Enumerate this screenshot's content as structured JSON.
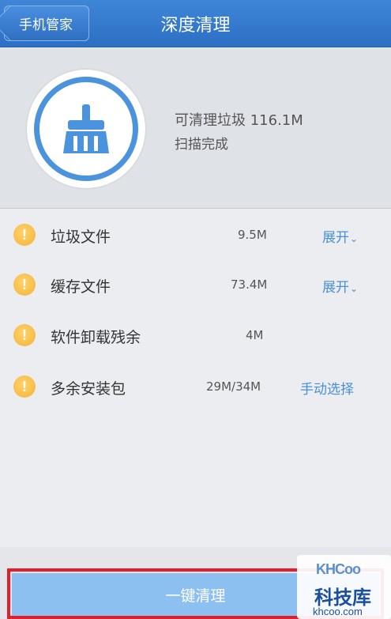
{
  "header": {
    "back_label": "手机管家",
    "title": "深度清理"
  },
  "summary": {
    "cleanable_text": "可清理垃圾 116.1M",
    "status_text": "扫描完成",
    "icon": "broom-icon"
  },
  "items": [
    {
      "label": "垃圾文件",
      "size": "9.5M",
      "action": "展开",
      "icon": "warning-icon"
    },
    {
      "label": "缓存文件",
      "size": "73.4M",
      "action": "展开",
      "icon": "warning-icon"
    },
    {
      "label": "软件卸载残余",
      "size": "4M",
      "action": "",
      "icon": "warning-icon"
    },
    {
      "label": "多余安装包",
      "size": "29M/34M",
      "action": "手动选择",
      "icon": "warning-icon"
    }
  ],
  "footer": {
    "clean_button_label": "一键清理"
  },
  "watermark": {
    "logo": "KHCoo",
    "name": "科技库",
    "url": "khcoo.com"
  },
  "colors": {
    "header": "#2c6fc3",
    "accent": "#4b93dc",
    "warning": "#f3b23a",
    "clean_button": "#8cc0f0",
    "highlight": "#e0202a"
  }
}
